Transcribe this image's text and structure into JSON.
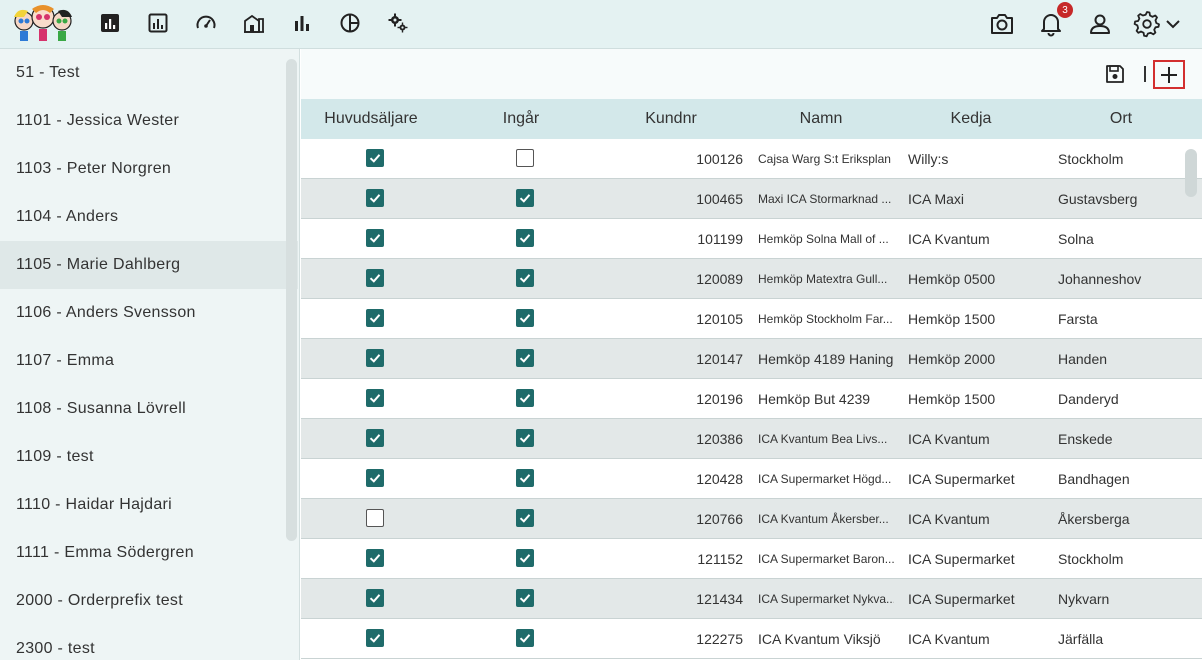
{
  "topbar": {
    "nav_icons": [
      "dashboard-icon",
      "report-icon",
      "speedometer-icon",
      "buildings-icon",
      "bar-chart-icon",
      "pie-chart-icon",
      "settings-cogs-icon"
    ],
    "notification_count": "3",
    "right_icons": [
      "camera-icon",
      "bell-icon",
      "user-icon",
      "gear-icon",
      "chevron-down-icon"
    ]
  },
  "sidebar": {
    "items": [
      {
        "label": "51 - Test"
      },
      {
        "label": "1101 - Jessica Wester"
      },
      {
        "label": "1103 - Peter Norgren"
      },
      {
        "label": "1104 - Anders"
      },
      {
        "label": "1105 - Marie Dahlberg"
      },
      {
        "label": "1106 - Anders Svensson"
      },
      {
        "label": "1107 - Emma"
      },
      {
        "label": "1108 - Susanna Lövrell"
      },
      {
        "label": "1109 - test"
      },
      {
        "label": "1110 - Haidar Hajdari"
      },
      {
        "label": "1111 - Emma Södergren"
      },
      {
        "label": "2000 - Orderprefix test"
      },
      {
        "label": "2300 - test"
      }
    ],
    "selected_index": 4
  },
  "table": {
    "headers": {
      "huvudsaljare": "Huvudsäljare",
      "ingar": "Ingår",
      "kundnr": "Kundnr",
      "namn": "Namn",
      "kedja": "Kedja",
      "ort": "Ort"
    },
    "rows": [
      {
        "huvudsaljare": true,
        "ingar": false,
        "kundnr": "100126",
        "namn": "Cajsa Warg S:t Eriksplan",
        "kedja": "Willy:s",
        "ort": "Stockholm"
      },
      {
        "huvudsaljare": true,
        "ingar": true,
        "kundnr": "100465",
        "namn": "Maxi ICA Stormarknad ...",
        "kedja": "ICA Maxi",
        "ort": "Gustavsberg"
      },
      {
        "huvudsaljare": true,
        "ingar": true,
        "kundnr": "101199",
        "namn": "Hemköp Solna Mall of ...",
        "kedja": "ICA Kvantum",
        "ort": "Solna"
      },
      {
        "huvudsaljare": true,
        "ingar": true,
        "kundnr": "120089",
        "namn": "Hemköp Matextra Gull...",
        "kedja": "Hemköp 0500",
        "ort": "Johanneshov"
      },
      {
        "huvudsaljare": true,
        "ingar": true,
        "kundnr": "120105",
        "namn": "Hemköp Stockholm Far...",
        "kedja": "Hemköp 1500",
        "ort": "Farsta"
      },
      {
        "huvudsaljare": true,
        "ingar": true,
        "kundnr": "120147",
        "namn": "Hemköp 4189 Haninge",
        "kedja": "Hemköp 2000",
        "ort": "Handen",
        "big": true
      },
      {
        "huvudsaljare": true,
        "ingar": true,
        "kundnr": "120196",
        "namn": "Hemköp But 4239",
        "kedja": "Hemköp 1500",
        "ort": "Danderyd",
        "big": true
      },
      {
        "huvudsaljare": true,
        "ingar": true,
        "kundnr": "120386",
        "namn": "ICA Kvantum Bea Livs...",
        "kedja": "ICA Kvantum",
        "ort": "Enskede"
      },
      {
        "huvudsaljare": true,
        "ingar": true,
        "kundnr": "120428",
        "namn": "ICA Supermarket Högd...",
        "kedja": "ICA Supermarket",
        "ort": "Bandhagen"
      },
      {
        "huvudsaljare": false,
        "ingar": true,
        "kundnr": "120766",
        "namn": "ICA Kvantum Åkersber...",
        "kedja": "ICA Kvantum",
        "ort": "Åkersberga"
      },
      {
        "huvudsaljare": true,
        "ingar": true,
        "kundnr": "121152",
        "namn": "ICA Supermarket Baron...",
        "kedja": "ICA Supermarket",
        "ort": "Stockholm"
      },
      {
        "huvudsaljare": true,
        "ingar": true,
        "kundnr": "121434",
        "namn": "ICA Supermarket Nykva...",
        "kedja": "ICA Supermarket",
        "ort": "Nykvarn"
      },
      {
        "huvudsaljare": true,
        "ingar": true,
        "kundnr": "122275",
        "namn": "ICA Kvantum Viksjö",
        "kedja": "ICA Kvantum",
        "ort": "Järfälla",
        "big": true
      }
    ]
  },
  "colors": {
    "topbar_bg": "#e4f2f2",
    "header_bg": "#d3e8ea",
    "checkbox_checked": "#1f6b6a",
    "badge": "#c62828",
    "add_button_border": "#d32f2f"
  }
}
